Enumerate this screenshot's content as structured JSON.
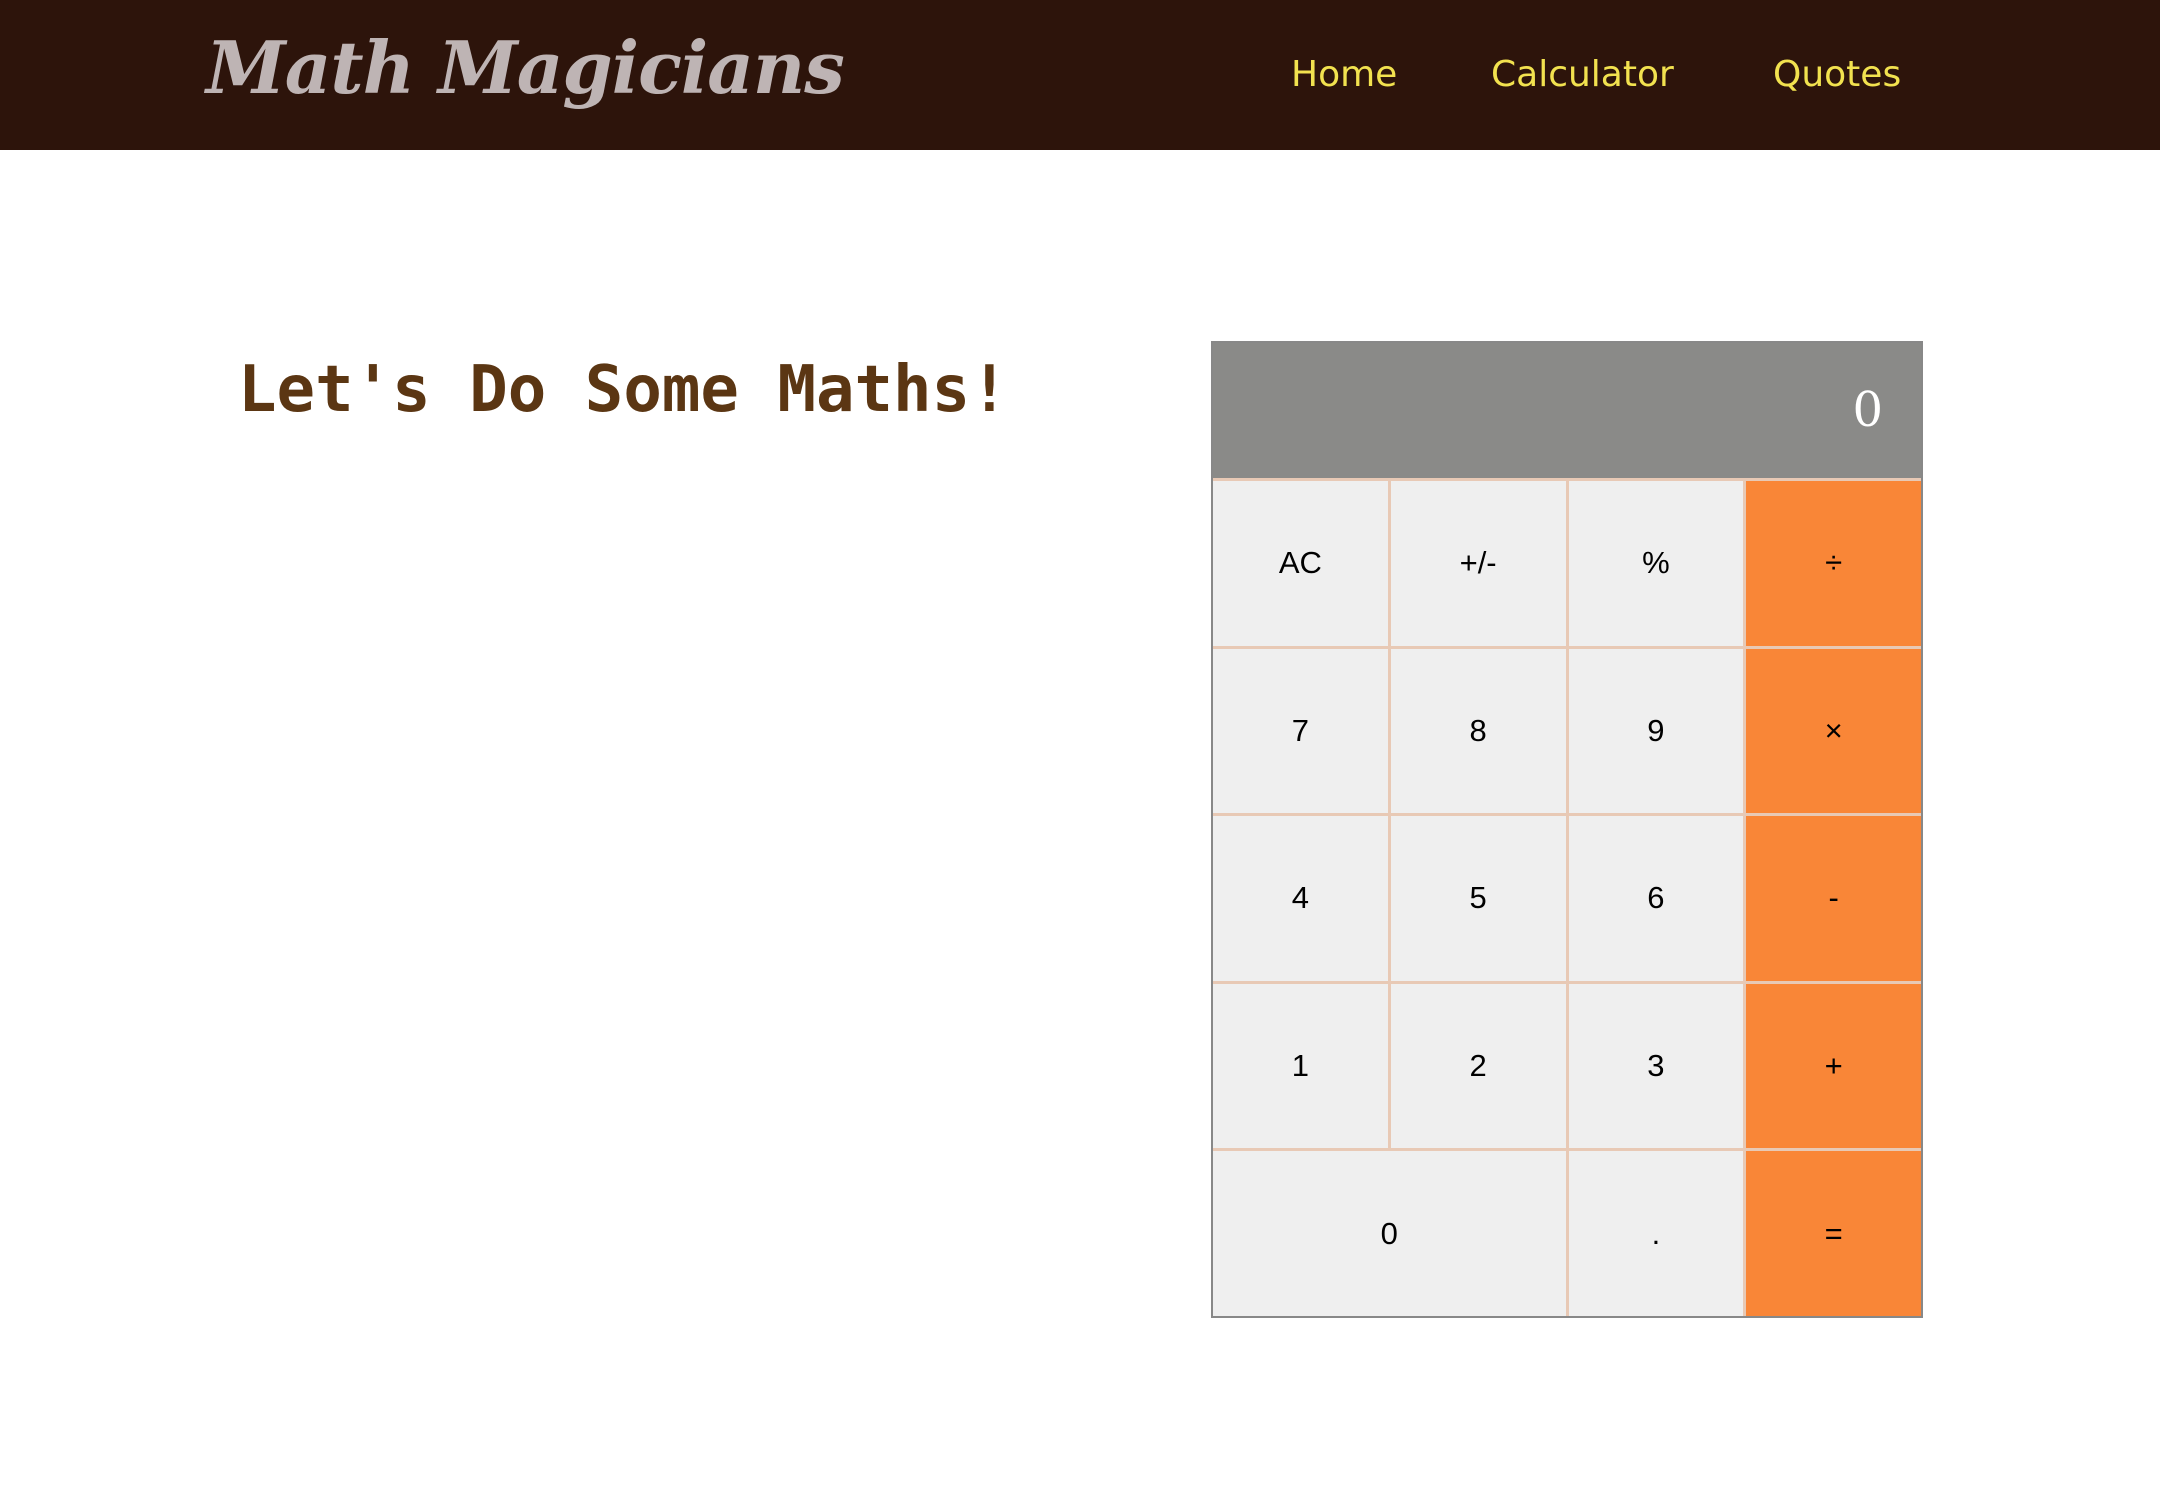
{
  "navbar": {
    "logo": "Math Magicians",
    "links": [
      "Home",
      "Calculator",
      "Quotes"
    ]
  },
  "main": {
    "heading": "Let's Do Some Maths!"
  },
  "calculator": {
    "display": "0",
    "keys": {
      "ac": "AC",
      "sign": "+/-",
      "percent": "%",
      "divide": "÷",
      "seven": "7",
      "eight": "8",
      "nine": "9",
      "multiply": "×",
      "four": "4",
      "five": "5",
      "six": "6",
      "minus": "-",
      "one": "1",
      "two": "2",
      "three": "3",
      "plus": "+",
      "zero": "0",
      "decimal": ".",
      "equals": "="
    }
  },
  "colors": {
    "navbar_bg": "#2d140b",
    "logo": "#beb4b4",
    "nav_link": "#f2e24f",
    "heading": "#5b3613",
    "display_bg": "#8a8a88",
    "key_bg": "#efefef",
    "operator_bg": "#f98637",
    "grid_line": "#e8c9b5"
  }
}
